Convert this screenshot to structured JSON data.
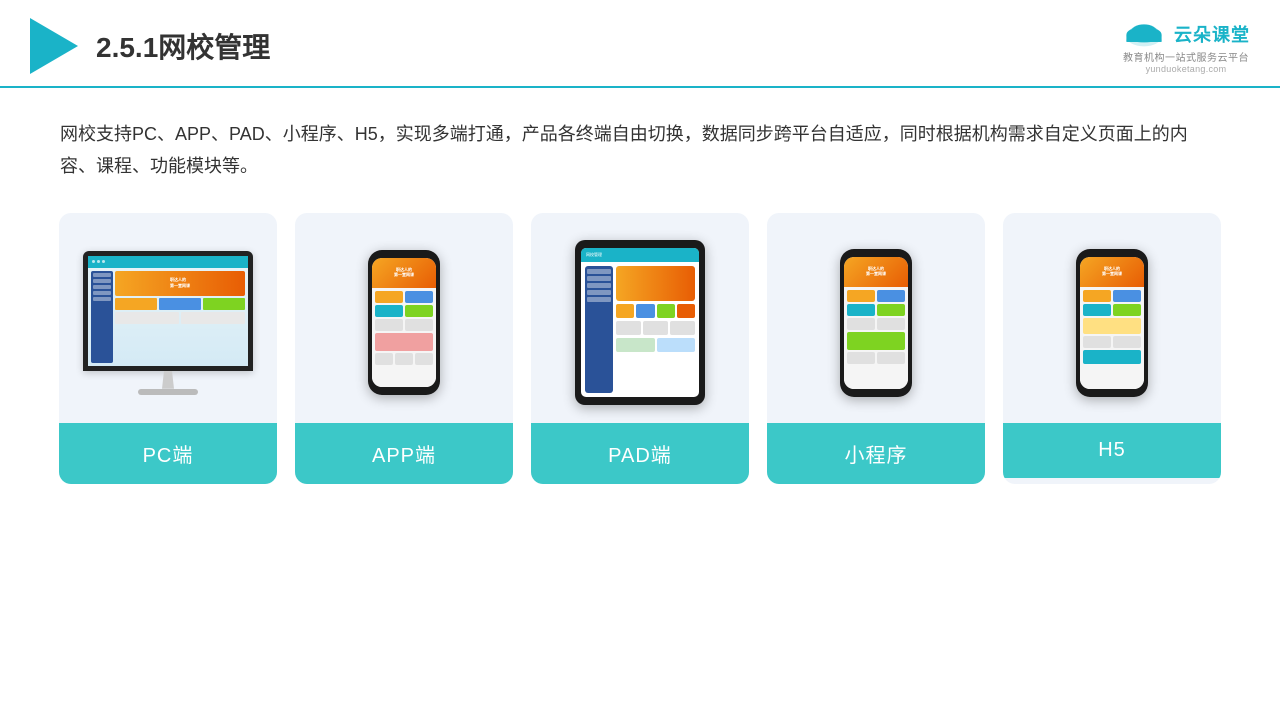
{
  "header": {
    "title": "2.5.1网校管理",
    "brand_name": "云朵课堂",
    "brand_url": "yunduoketang.com",
    "brand_tagline": "教育机构一站\n式服务云平台"
  },
  "description": "网校支持PC、APP、PAD、小程序、H5，实现多端打通，产品各终端自由切换，数据同步跨平台自适应，同时根据机构需求自定义页面上的内容、课程、功能模块等。",
  "cards": [
    {
      "id": "pc",
      "label": "PC端"
    },
    {
      "id": "app",
      "label": "APP端"
    },
    {
      "id": "pad",
      "label": "PAD端"
    },
    {
      "id": "miniprogram",
      "label": "小程序"
    },
    {
      "id": "h5",
      "label": "H5"
    }
  ],
  "colors": {
    "accent": "#1ab3c8",
    "card_bg": "#f0f4fa",
    "label_bg": "#3cc8c8"
  }
}
